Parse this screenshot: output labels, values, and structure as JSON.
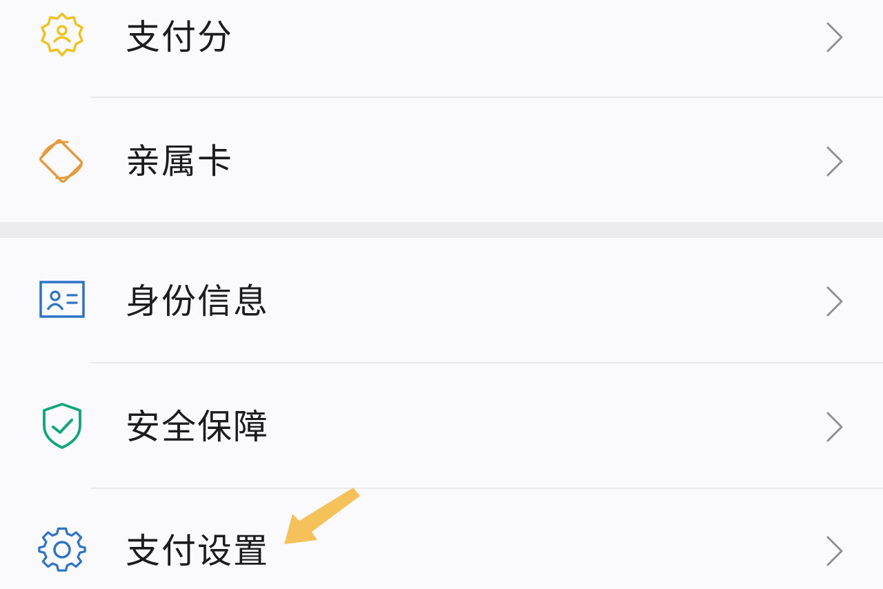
{
  "colors": {
    "payscore": "#f1c21b",
    "family_card": "#e79a3a",
    "identity": "#2a73c8",
    "security": "#0ba77a",
    "settings": "#2a73c8",
    "chevron": "#8e8e94",
    "annotation_arrow": "#f5c25a"
  },
  "menu": {
    "group1": [
      {
        "label": "支付分",
        "icon": "payscore-badge-icon"
      },
      {
        "label": "亲属卡",
        "icon": "family-card-icon"
      }
    ],
    "group2": [
      {
        "label": "身份信息",
        "icon": "id-card-icon"
      },
      {
        "label": "安全保障",
        "icon": "shield-check-icon"
      },
      {
        "label": "支付设置",
        "icon": "gear-icon"
      }
    ]
  },
  "annotation": {
    "icon": "pointer-arrow-icon"
  }
}
